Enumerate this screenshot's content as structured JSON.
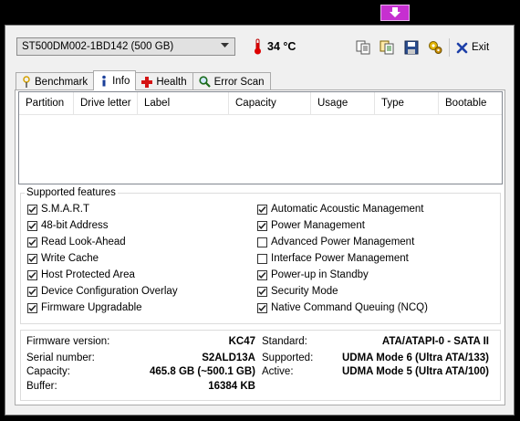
{
  "drive": {
    "selected": "ST500DM002-1BD142 (500 GB)"
  },
  "temperature": {
    "value": "34 °C"
  },
  "toolbar": {
    "icons": [
      "copy-icon",
      "copy-all-icon",
      "save-icon",
      "options-icon",
      "exit-icon"
    ],
    "exit_label": "Exit"
  },
  "tabs": [
    {
      "label": "Benchmark",
      "icon": "benchmark-icon"
    },
    {
      "label": "Info",
      "icon": "info-icon",
      "active": true
    },
    {
      "label": "Health",
      "icon": "health-icon"
    },
    {
      "label": "Error Scan",
      "icon": "magnifier-icon"
    }
  ],
  "partition_table": {
    "columns": [
      "Partition",
      "Drive letter",
      "Label",
      "Capacity",
      "Usage",
      "Type",
      "Bootable"
    ],
    "rows": []
  },
  "features": {
    "title": "Supported features",
    "left": [
      {
        "label": "S.M.A.R.T",
        "checked": true
      },
      {
        "label": "48-bit Address",
        "checked": true
      },
      {
        "label": "Read Look-Ahead",
        "checked": true
      },
      {
        "label": "Write Cache",
        "checked": true
      },
      {
        "label": "Host Protected Area",
        "checked": true
      },
      {
        "label": "Device Configuration Overlay",
        "checked": true
      },
      {
        "label": "Firmware Upgradable",
        "checked": true
      }
    ],
    "right": [
      {
        "label": "Automatic Acoustic Management",
        "checked": true
      },
      {
        "label": "Power Management",
        "checked": true
      },
      {
        "label": "Advanced Power Management",
        "checked": false
      },
      {
        "label": "Interface Power Management",
        "checked": false
      },
      {
        "label": "Power-up in Standby",
        "checked": true
      },
      {
        "label": "Security Mode",
        "checked": true
      },
      {
        "label": "Native Command Queuing (NCQ)",
        "checked": true
      }
    ]
  },
  "info": {
    "firmware_label": "Firmware version:",
    "firmware_value": "KC47",
    "serial_label": "Serial number:",
    "serial_value": "S2ALD13A",
    "capacity_label": "Capacity:",
    "capacity_value": "465.8 GB (~500.1 GB)",
    "buffer_label": "Buffer:",
    "buffer_value": "16384 KB",
    "standard_label": "Standard:",
    "standard_value": "ATA/ATAPI-0 - SATA II",
    "supported_label": "Supported:",
    "supported_value": "UDMA Mode 6 (Ultra ATA/133)",
    "active_label": "Active:",
    "active_value": "UDMA Mode 5 (Ultra ATA/100)"
  },
  "colors": {
    "accent_titlebar": "#c62fd0",
    "background": "#000000",
    "window": "#f0f0f0"
  }
}
